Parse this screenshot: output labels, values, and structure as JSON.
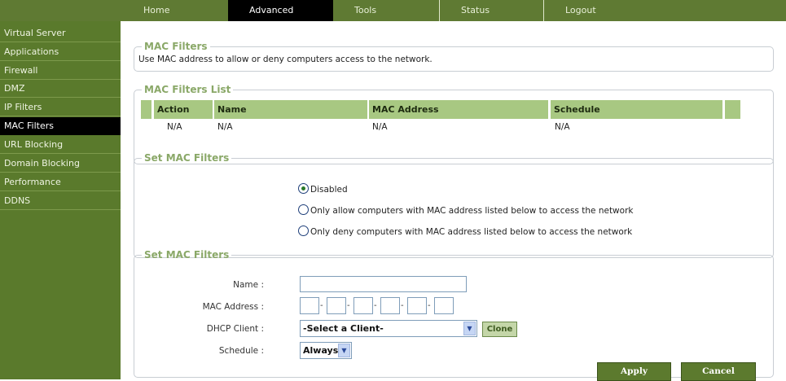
{
  "nav": {
    "tabs": [
      "Home",
      "Advanced",
      "Tools",
      "Status",
      "Logout"
    ],
    "active_tab": "Advanced"
  },
  "sidebar": {
    "items": [
      "Virtual Server",
      "Applications",
      "Firewall",
      "DMZ",
      "IP Filters",
      "MAC Filters",
      "URL Blocking",
      "Domain Blocking",
      "Performance",
      "DDNS"
    ],
    "active_item": "MAC Filters"
  },
  "mac_filters": {
    "title": "MAC Filters",
    "description": "Use MAC address to allow or deny computers access to the network."
  },
  "filters_list": {
    "title": "MAC Filters List",
    "columns": [
      "Action",
      "Name",
      "MAC Address",
      "Schedule"
    ],
    "rows": [
      [
        "N/A",
        "N/A",
        "N/A",
        "N/A"
      ]
    ]
  },
  "set_mode": {
    "title": "Set MAC Filters",
    "options": [
      "Disabled",
      "Only allow computers with MAC address listed below to access the network",
      "Only deny computers with MAC address listed below to access the network"
    ],
    "selected_index": 0
  },
  "set_entry": {
    "title": "Set MAC Filters",
    "name_label": "Name :",
    "name_value": "",
    "mac_label": "MAC Address :",
    "mac_separator": "-",
    "mac_octets": [
      "",
      "",
      "",
      "",
      "",
      ""
    ],
    "dhcp_label": "DHCP Client :",
    "dhcp_selected": "-Select a Client-",
    "clone_label": "Clone",
    "schedule_label": "Schedule :",
    "schedule_selected": "Always",
    "apply_label": "Apply",
    "cancel_label": "Cancel"
  },
  "colors": {
    "nav_bg": "#5f7a33",
    "sidebar_bg": "#5a7a2c",
    "active_bg": "#000000",
    "legend": "#8aa868",
    "table_header": "#a8c882",
    "button": "#5c7a2e"
  }
}
